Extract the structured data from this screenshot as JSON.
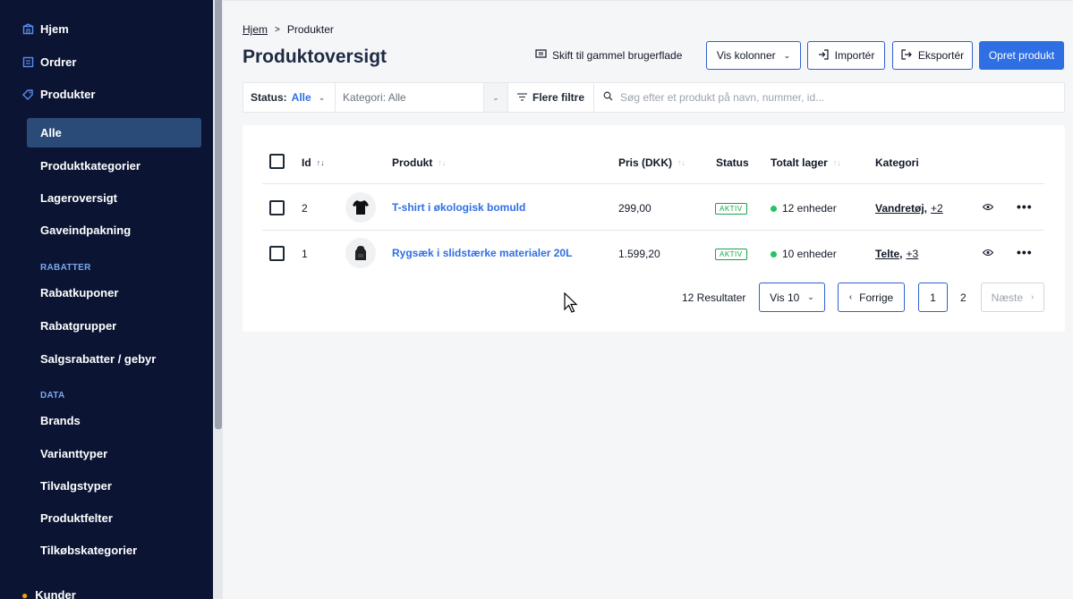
{
  "sidebar": {
    "top_items": [
      {
        "label": "Hjem",
        "icon": "home-icon"
      },
      {
        "label": "Ordrer",
        "icon": "orders-icon"
      },
      {
        "label": "Produkter",
        "icon": "tag-icon"
      }
    ],
    "product_items": [
      {
        "label": "Alle",
        "active": true
      },
      {
        "label": "Produktkategorier"
      },
      {
        "label": "Lageroversigt"
      },
      {
        "label": "Gaveindpakning"
      }
    ],
    "section_rabatter": "RABATTER",
    "rabatter_items": [
      {
        "label": "Rabatkuponer"
      },
      {
        "label": "Rabatgrupper"
      },
      {
        "label": "Salgsrabatter / gebyr"
      }
    ],
    "section_data": "DATA",
    "data_items": [
      {
        "label": "Brands"
      },
      {
        "label": "Varianttyper"
      },
      {
        "label": "Tilvalgstyper"
      },
      {
        "label": "Produktfelter"
      },
      {
        "label": "Tilkøbskategorier"
      }
    ],
    "bottom_item": {
      "label": "Kunder",
      "icon": "user-icon"
    }
  },
  "breadcrumb": {
    "home": "Hjem",
    "current": "Produkter"
  },
  "page_title": "Produktoversigt",
  "toolbar": {
    "switch_label": "Skift til gammel brugerflade",
    "columns_label": "Vis kolonner",
    "import_label": "Importér",
    "export_label": "Eksportér",
    "create_label": "Opret produkt"
  },
  "filters": {
    "status_label": "Status:",
    "status_value": "Alle",
    "category_value": "Kategori: Alle",
    "more_filters_label": "Flere filtre",
    "search_placeholder": "Søg efter et produkt på navn, nummer, id..."
  },
  "table": {
    "headers": {
      "id": "Id",
      "product": "Produkt",
      "price": "Pris (DKK)",
      "status": "Status",
      "stock": "Totalt lager",
      "category": "Kategori"
    },
    "rows": [
      {
        "id": "2",
        "product": "T-shirt i økologisk bomuld",
        "price": "299,00",
        "status": "AKTIV",
        "stock": "12 enheder",
        "category": "Vandretøj,",
        "category_more": "+2",
        "thumb": "tshirt"
      },
      {
        "id": "1",
        "product": "Rygsæk i slidstærke materialer 20L",
        "price": "1.599,20",
        "status": "AKTIV",
        "stock": "10 enheder",
        "category": "Telte,",
        "category_more": "+3",
        "thumb": "backpack"
      }
    ]
  },
  "pagination": {
    "results": "12 Resultater",
    "per_page": "Vis 10",
    "prev_label": "Forrige",
    "pages": [
      "1",
      "2"
    ],
    "next_label": "Næste"
  },
  "colors": {
    "sidebar_bg": "#0b1533",
    "accent": "#2f6fe4",
    "active_item": "#2a4a78",
    "status_green": "#16a34a"
  }
}
